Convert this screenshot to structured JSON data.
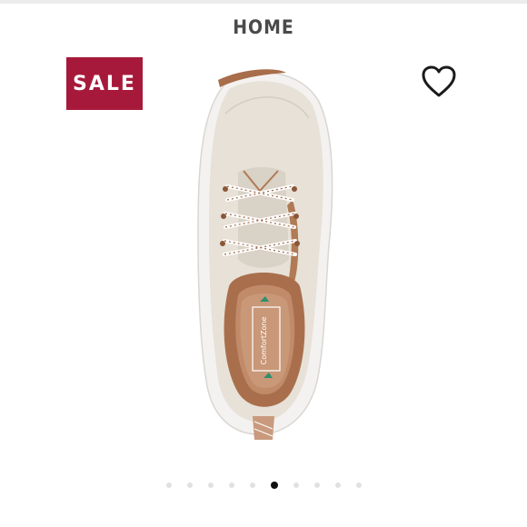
{
  "header": {
    "title": "HOME"
  },
  "product": {
    "badge": "SALE",
    "badge_color": "#a7193a",
    "favorite_icon": "heart-outline-icon",
    "insole_brand": "ComfortZone"
  },
  "carousel": {
    "total": 10,
    "active_index": 5
  },
  "colors": {
    "title": "#4a4a4a",
    "dot_inactive": "#e1e1e1",
    "dot_active": "#111111"
  }
}
